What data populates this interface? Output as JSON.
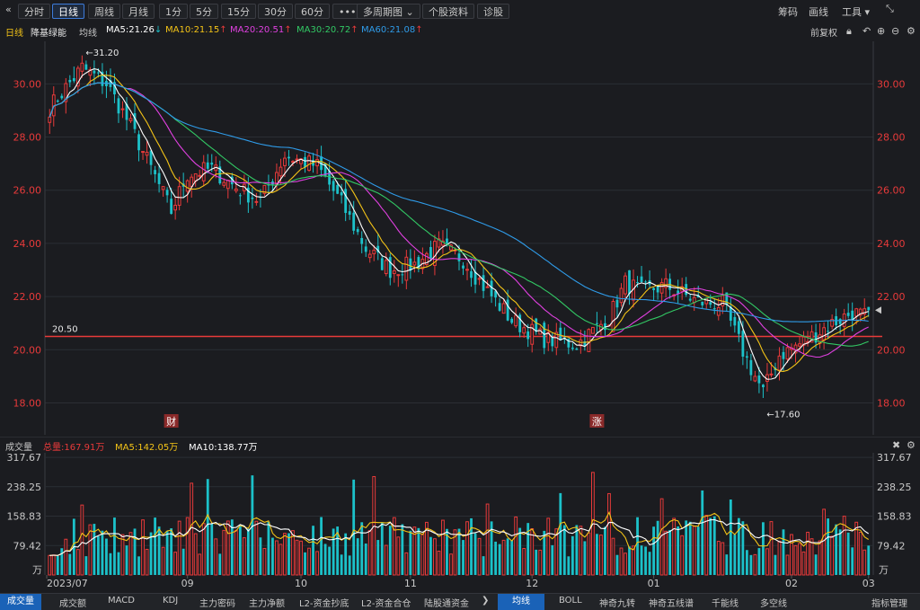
{
  "toolbar": {
    "back_icon": "double-chevron-left",
    "periods": [
      "分时",
      "日线",
      "周线",
      "月线",
      "1分",
      "5分",
      "15分",
      "30分",
      "60分"
    ],
    "active_period": "日线",
    "more_icon": "more-dots",
    "multi_period": "多周期图",
    "stock_info": "个股资料",
    "diagnose": "诊股",
    "right": {
      "chip": "筹码",
      "draw": "画线",
      "tools": "工具",
      "expand_icon": "expand-arrows"
    }
  },
  "main_legend": {
    "period": "日线",
    "stock_name": "降基绿能",
    "avg_line": "均线",
    "ma5": "MA5:21.26",
    "ma10": "MA10:21.15",
    "ma20": "MA20:20.51",
    "ma30": "MA30:20.72",
    "ma60": "MA60:21.08",
    "fq": "前复权",
    "colors": {
      "ma5": "#ffffff",
      "ma10": "#f3c317",
      "ma20": "#e040e0",
      "ma30": "#32c864",
      "ma60": "#2f9be8"
    }
  },
  "volume_legend": {
    "title": "成交量",
    "total": "总量:167.91万",
    "ma5": "MA5:142.05万",
    "ma10": "MA10:138.77万"
  },
  "chart_data": {
    "type": "candlestick",
    "price_axis_ticks": [
      "30.00",
      "28.00",
      "26.00",
      "24.00",
      "22.00",
      "20.00",
      "18.00"
    ],
    "price_range": [
      16.8,
      31.6
    ],
    "hline": {
      "label": "20.50",
      "value": 20.5
    },
    "annotations": [
      {
        "text": "←31.20",
        "value": 31.2,
        "note": "period high"
      },
      {
        "text": "←17.60",
        "value": 17.6,
        "note": "period low"
      }
    ],
    "event_markers": [
      "财",
      "涨"
    ],
    "x_labels": [
      "2023/07",
      "09",
      "10",
      "11",
      "12",
      "01",
      "02",
      "03"
    ],
    "volume_axis_ticks": [
      "317.67",
      "238.25",
      "158.83",
      "79.42"
    ],
    "volume_unit": "万",
    "volume_range": [
      0,
      330
    ],
    "colors": {
      "up": "#e83a3a",
      "down": "#1cc1c9",
      "grid": "#2b2e34",
      "hline": "#e83a3a"
    }
  },
  "bottom_tabs": {
    "left": [
      "成交量",
      "成交额",
      "MACD",
      "KDJ",
      "主力密码",
      "主力净额",
      "L2-资金抄底",
      "L2-资金合仓",
      "陆股通资金"
    ],
    "active_left": "成交量",
    "right": [
      "均线",
      "BOLL",
      "神奇九转",
      "神奇五线谱",
      "千能线",
      "多空线",
      "指标管理"
    ],
    "active_right": "均线"
  }
}
